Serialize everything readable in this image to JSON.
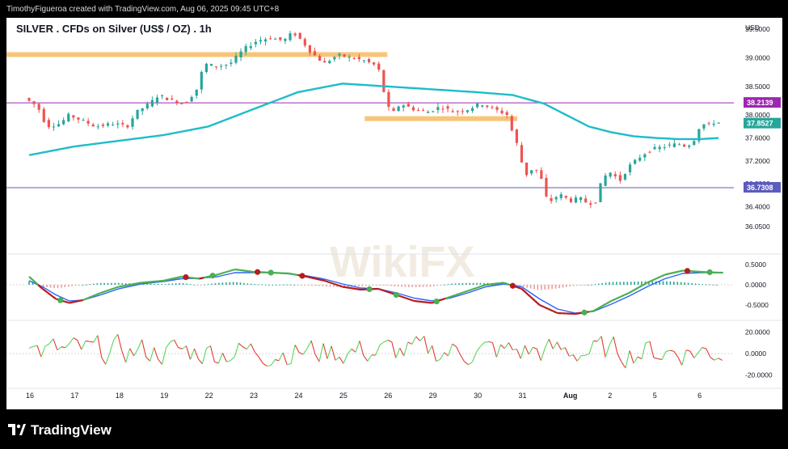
{
  "header": {
    "attribution": "TimothyFigueroa created with TradingView.com, Aug 06, 2025 09:45 UTC+8"
  },
  "footer": {
    "brand": "TradingView"
  },
  "watermark": "WikiFX",
  "colors": {
    "up": "#26a69a",
    "down": "#ef5350",
    "ma": "#1fbcc9",
    "zone": "#f7c57a",
    "level_line": "#9c27b0",
    "level_line_blue": "#5b5bbf",
    "badge_purple": "#9c27b0",
    "badge_green": "#26a69a",
    "badge_blue": "#5b5bbf",
    "macd_red": "#b71c1c",
    "macd_green": "#4caf50",
    "macd_blue": "#2962ff",
    "osc_green": "#5bd75b",
    "osc_red": "#e53935"
  },
  "chart_data": {
    "type": "candlestick",
    "title": "SILVER . CFDs on Silver (US$ / OZ) . 1h",
    "currency_label": "USD",
    "x_ticks": [
      "16",
      "17",
      "18",
      "19",
      "22",
      "23",
      "24",
      "25",
      "26",
      "29",
      "30",
      "31",
      "Aug",
      "2",
      "5",
      "6"
    ],
    "price_axis": {
      "min": 35.6,
      "max": 39.7,
      "ticks": [
        "39.5000",
        "39.0000",
        "38.5000",
        "38.0000",
        "37.6000",
        "37.2000",
        "36.8000",
        "36.4000",
        "36.0500"
      ]
    },
    "price_badges": [
      {
        "label": "38.2139",
        "value": 38.2139,
        "color": "purple"
      },
      {
        "label": "37.8527",
        "value": 37.8527,
        "color": "green"
      },
      {
        "label": "36.7308",
        "value": 36.7308,
        "color": "blue"
      }
    ],
    "horizontal_lines": [
      38.2139,
      36.7308
    ],
    "zones": [
      {
        "from_day": 0,
        "to_day": 8.0,
        "low": 39.02,
        "high": 39.1
      },
      {
        "from_day": 8.0,
        "to_day": 10.9,
        "low": 37.92,
        "high": 37.98
      }
    ],
    "price_path": [
      [
        0,
        38.3
      ],
      [
        0.3,
        38.15
      ],
      [
        0.5,
        37.8
      ],
      [
        0.8,
        37.85
      ],
      [
        1.0,
        38.0
      ],
      [
        1.3,
        37.9
      ],
      [
        1.6,
        37.8
      ],
      [
        2.0,
        37.85
      ],
      [
        2.3,
        37.8
      ],
      [
        2.5,
        38.05
      ],
      [
        2.8,
        38.2
      ],
      [
        3.0,
        38.35
      ],
      [
        3.3,
        38.25
      ],
      [
        3.6,
        38.2
      ],
      [
        3.9,
        38.5
      ],
      [
        4.0,
        38.9
      ],
      [
        4.3,
        38.85
      ],
      [
        4.6,
        38.9
      ],
      [
        4.9,
        39.15
      ],
      [
        5.2,
        39.3
      ],
      [
        5.5,
        39.35
      ],
      [
        5.8,
        39.3
      ],
      [
        6.0,
        39.45
      ],
      [
        6.2,
        39.3
      ],
      [
        6.4,
        39.1
      ],
      [
        6.7,
        38.9
      ],
      [
        7.0,
        39.05
      ],
      [
        7.3,
        39.0
      ],
      [
        7.6,
        38.95
      ],
      [
        7.9,
        38.85
      ],
      [
        8.0,
        38.5
      ],
      [
        8.1,
        38.2
      ],
      [
        8.2,
        38.0
      ],
      [
        8.4,
        38.2
      ],
      [
        8.7,
        38.1
      ],
      [
        9.0,
        38.05
      ],
      [
        9.3,
        38.15
      ],
      [
        9.6,
        38.05
      ],
      [
        9.9,
        38.1
      ],
      [
        10.2,
        38.2
      ],
      [
        10.5,
        38.1
      ],
      [
        10.8,
        38.0
      ],
      [
        10.9,
        37.7
      ],
      [
        11.0,
        37.5
      ],
      [
        11.1,
        37.2
      ],
      [
        11.2,
        36.95
      ],
      [
        11.4,
        37.1
      ],
      [
        11.6,
        36.8
      ],
      [
        11.7,
        36.4
      ],
      [
        11.8,
        36.55
      ],
      [
        12.0,
        36.6
      ],
      [
        12.2,
        36.5
      ],
      [
        12.4,
        36.55
      ],
      [
        12.6,
        36.45
      ],
      [
        12.8,
        36.5
      ],
      [
        12.9,
        36.9
      ],
      [
        13.1,
        37.0
      ],
      [
        13.3,
        36.85
      ],
      [
        13.5,
        37.1
      ],
      [
        13.8,
        37.3
      ],
      [
        14.0,
        37.4
      ],
      [
        14.3,
        37.45
      ],
      [
        14.6,
        37.5
      ],
      [
        14.8,
        37.45
      ],
      [
        15.0,
        37.6
      ],
      [
        15.1,
        37.85
      ],
      [
        15.3,
        37.82
      ],
      [
        15.4,
        37.87
      ]
    ],
    "moving_average": [
      [
        0,
        37.3
      ],
      [
        1,
        37.45
      ],
      [
        2,
        37.55
      ],
      [
        3,
        37.65
      ],
      [
        4,
        37.8
      ],
      [
        5,
        38.1
      ],
      [
        6,
        38.4
      ],
      [
        7,
        38.55
      ],
      [
        8,
        38.5
      ],
      [
        9,
        38.45
      ],
      [
        10,
        38.4
      ],
      [
        10.8,
        38.35
      ],
      [
        11.5,
        38.2
      ],
      [
        12,
        38.0
      ],
      [
        12.5,
        37.8
      ],
      [
        13,
        37.7
      ],
      [
        13.5,
        37.63
      ],
      [
        14,
        37.6
      ],
      [
        14.5,
        37.58
      ],
      [
        15,
        37.58
      ],
      [
        15.4,
        37.6
      ]
    ],
    "macd": {
      "axis_ticks": [
        "0.5000",
        "0.0000",
        "-0.5000"
      ],
      "range": [
        -0.8,
        0.7
      ],
      "macd_line": [
        [
          0,
          0.2
        ],
        [
          0.3,
          -0.1
        ],
        [
          0.6,
          -0.35
        ],
        [
          0.9,
          -0.45
        ],
        [
          1.2,
          -0.38
        ],
        [
          1.6,
          -0.2
        ],
        [
          2.0,
          -0.05
        ],
        [
          2.5,
          0.05
        ],
        [
          3.0,
          0.1
        ],
        [
          3.4,
          0.2
        ],
        [
          3.8,
          0.15
        ],
        [
          4.2,
          0.25
        ],
        [
          4.6,
          0.38
        ],
        [
          5.0,
          0.32
        ],
        [
          5.4,
          0.3
        ],
        [
          5.8,
          0.28
        ],
        [
          6.2,
          0.2
        ],
        [
          6.6,
          0.1
        ],
        [
          7.0,
          -0.05
        ],
        [
          7.4,
          -0.12
        ],
        [
          7.8,
          -0.1
        ],
        [
          8.2,
          -0.25
        ],
        [
          8.6,
          -0.4
        ],
        [
          9.0,
          -0.45
        ],
        [
          9.4,
          -0.3
        ],
        [
          9.8,
          -0.15
        ],
        [
          10.2,
          0.0
        ],
        [
          10.6,
          0.05
        ],
        [
          11.0,
          -0.1
        ],
        [
          11.4,
          -0.5
        ],
        [
          11.8,
          -0.7
        ],
        [
          12.2,
          -0.72
        ],
        [
          12.6,
          -0.65
        ],
        [
          13.0,
          -0.4
        ],
        [
          13.4,
          -0.2
        ],
        [
          13.8,
          0.05
        ],
        [
          14.2,
          0.25
        ],
        [
          14.6,
          0.35
        ],
        [
          15.0,
          0.32
        ],
        [
          15.4,
          0.3
        ]
      ],
      "signal_line": [
        [
          0,
          0.1
        ],
        [
          0.3,
          -0.05
        ],
        [
          0.6,
          -0.25
        ],
        [
          0.9,
          -0.4
        ],
        [
          1.2,
          -0.38
        ],
        [
          1.6,
          -0.25
        ],
        [
          2.0,
          -0.1
        ],
        [
          2.5,
          0.02
        ],
        [
          3.0,
          0.08
        ],
        [
          3.4,
          0.15
        ],
        [
          3.8,
          0.16
        ],
        [
          4.2,
          0.2
        ],
        [
          4.6,
          0.3
        ],
        [
          5.0,
          0.3
        ],
        [
          5.4,
          0.3
        ],
        [
          5.8,
          0.27
        ],
        [
          6.2,
          0.22
        ],
        [
          6.6,
          0.14
        ],
        [
          7.0,
          0.02
        ],
        [
          7.4,
          -0.08
        ],
        [
          7.8,
          -0.1
        ],
        [
          8.2,
          -0.2
        ],
        [
          8.6,
          -0.33
        ],
        [
          9.0,
          -0.4
        ],
        [
          9.4,
          -0.33
        ],
        [
          9.8,
          -0.2
        ],
        [
          10.2,
          -0.05
        ],
        [
          10.6,
          0.02
        ],
        [
          11.0,
          -0.05
        ],
        [
          11.4,
          -0.35
        ],
        [
          11.8,
          -0.6
        ],
        [
          12.2,
          -0.7
        ],
        [
          12.6,
          -0.66
        ],
        [
          13.0,
          -0.48
        ],
        [
          13.4,
          -0.28
        ],
        [
          13.8,
          -0.05
        ],
        [
          14.2,
          0.15
        ],
        [
          14.6,
          0.28
        ],
        [
          15.0,
          0.3
        ],
        [
          15.4,
          0.3
        ]
      ]
    },
    "oscillator": {
      "axis_ticks": [
        "20.0000",
        "0.0000",
        "-20.0000"
      ],
      "range": [
        -28,
        28
      ]
    }
  }
}
